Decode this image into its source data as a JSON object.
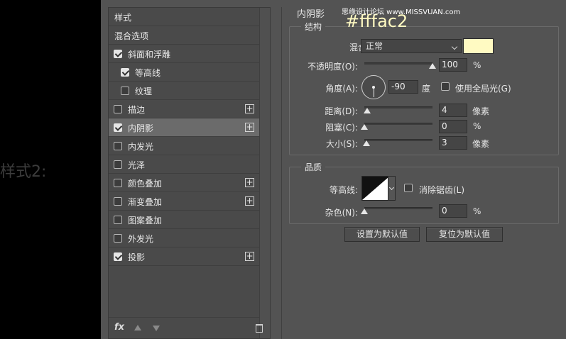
{
  "left_caption": "样式2:",
  "watermark": "思缘设计论坛 www.MISSVUAN.com",
  "color_annotation": "#fffac2",
  "style_list": [
    {
      "label": "样式",
      "has_checkbox": false,
      "checked": false,
      "has_plus": false
    },
    {
      "label": "混合选项",
      "has_checkbox": false,
      "checked": false,
      "has_plus": false
    },
    {
      "label": "斜面和浮雕",
      "has_checkbox": true,
      "checked": true,
      "has_plus": false
    },
    {
      "label": "等高线",
      "has_checkbox": true,
      "checked": true,
      "has_plus": false,
      "indent": true
    },
    {
      "label": "纹理",
      "has_checkbox": true,
      "checked": false,
      "has_plus": false,
      "indent": true
    },
    {
      "label": "描边",
      "has_checkbox": true,
      "checked": false,
      "has_plus": true
    },
    {
      "label": "内阴影",
      "has_checkbox": true,
      "checked": true,
      "has_plus": true,
      "selected": true
    },
    {
      "label": "内发光",
      "has_checkbox": true,
      "checked": false,
      "has_plus": false
    },
    {
      "label": "光泽",
      "has_checkbox": true,
      "checked": false,
      "has_plus": false
    },
    {
      "label": "颜色叠加",
      "has_checkbox": true,
      "checked": false,
      "has_plus": true
    },
    {
      "label": "渐变叠加",
      "has_checkbox": true,
      "checked": false,
      "has_plus": true
    },
    {
      "label": "图案叠加",
      "has_checkbox": true,
      "checked": false,
      "has_plus": false
    },
    {
      "label": "外发光",
      "has_checkbox": true,
      "checked": false,
      "has_plus": false
    },
    {
      "label": "投影",
      "has_checkbox": true,
      "checked": true,
      "has_plus": true
    }
  ],
  "footer": {
    "fx_label": "fx"
  },
  "inner_shadow": {
    "title": "内阴影",
    "structure_title": "结构",
    "blend_mode_label": "混合模式:",
    "blend_mode_value": "正常",
    "blend_color": "#fffac2",
    "opacity_label": "不透明度(O):",
    "opacity_value": "100",
    "opacity_unit": "%",
    "opacity_level": 1.0,
    "angle_label": "角度(A):",
    "angle_value": "-90",
    "angle_unit": "度",
    "global_light_label": "使用全局光(G)",
    "global_light_checked": false,
    "distance_label": "距离(D):",
    "distance_value": "4",
    "distance_unit": "像素",
    "choke_label": "阻塞(C):",
    "choke_value": "0",
    "choke_unit": "%",
    "size_label": "大小(S):",
    "size_value": "3",
    "size_unit": "像素",
    "quality_title": "品质",
    "contour_label": "等高线:",
    "anti_alias_label": "消除锯齿(L)",
    "anti_alias_checked": false,
    "noise_label": "杂色(N):",
    "noise_value": "0",
    "noise_unit": "%",
    "set_default_label": "设置为默认值",
    "reset_default_label": "复位为默认值"
  }
}
